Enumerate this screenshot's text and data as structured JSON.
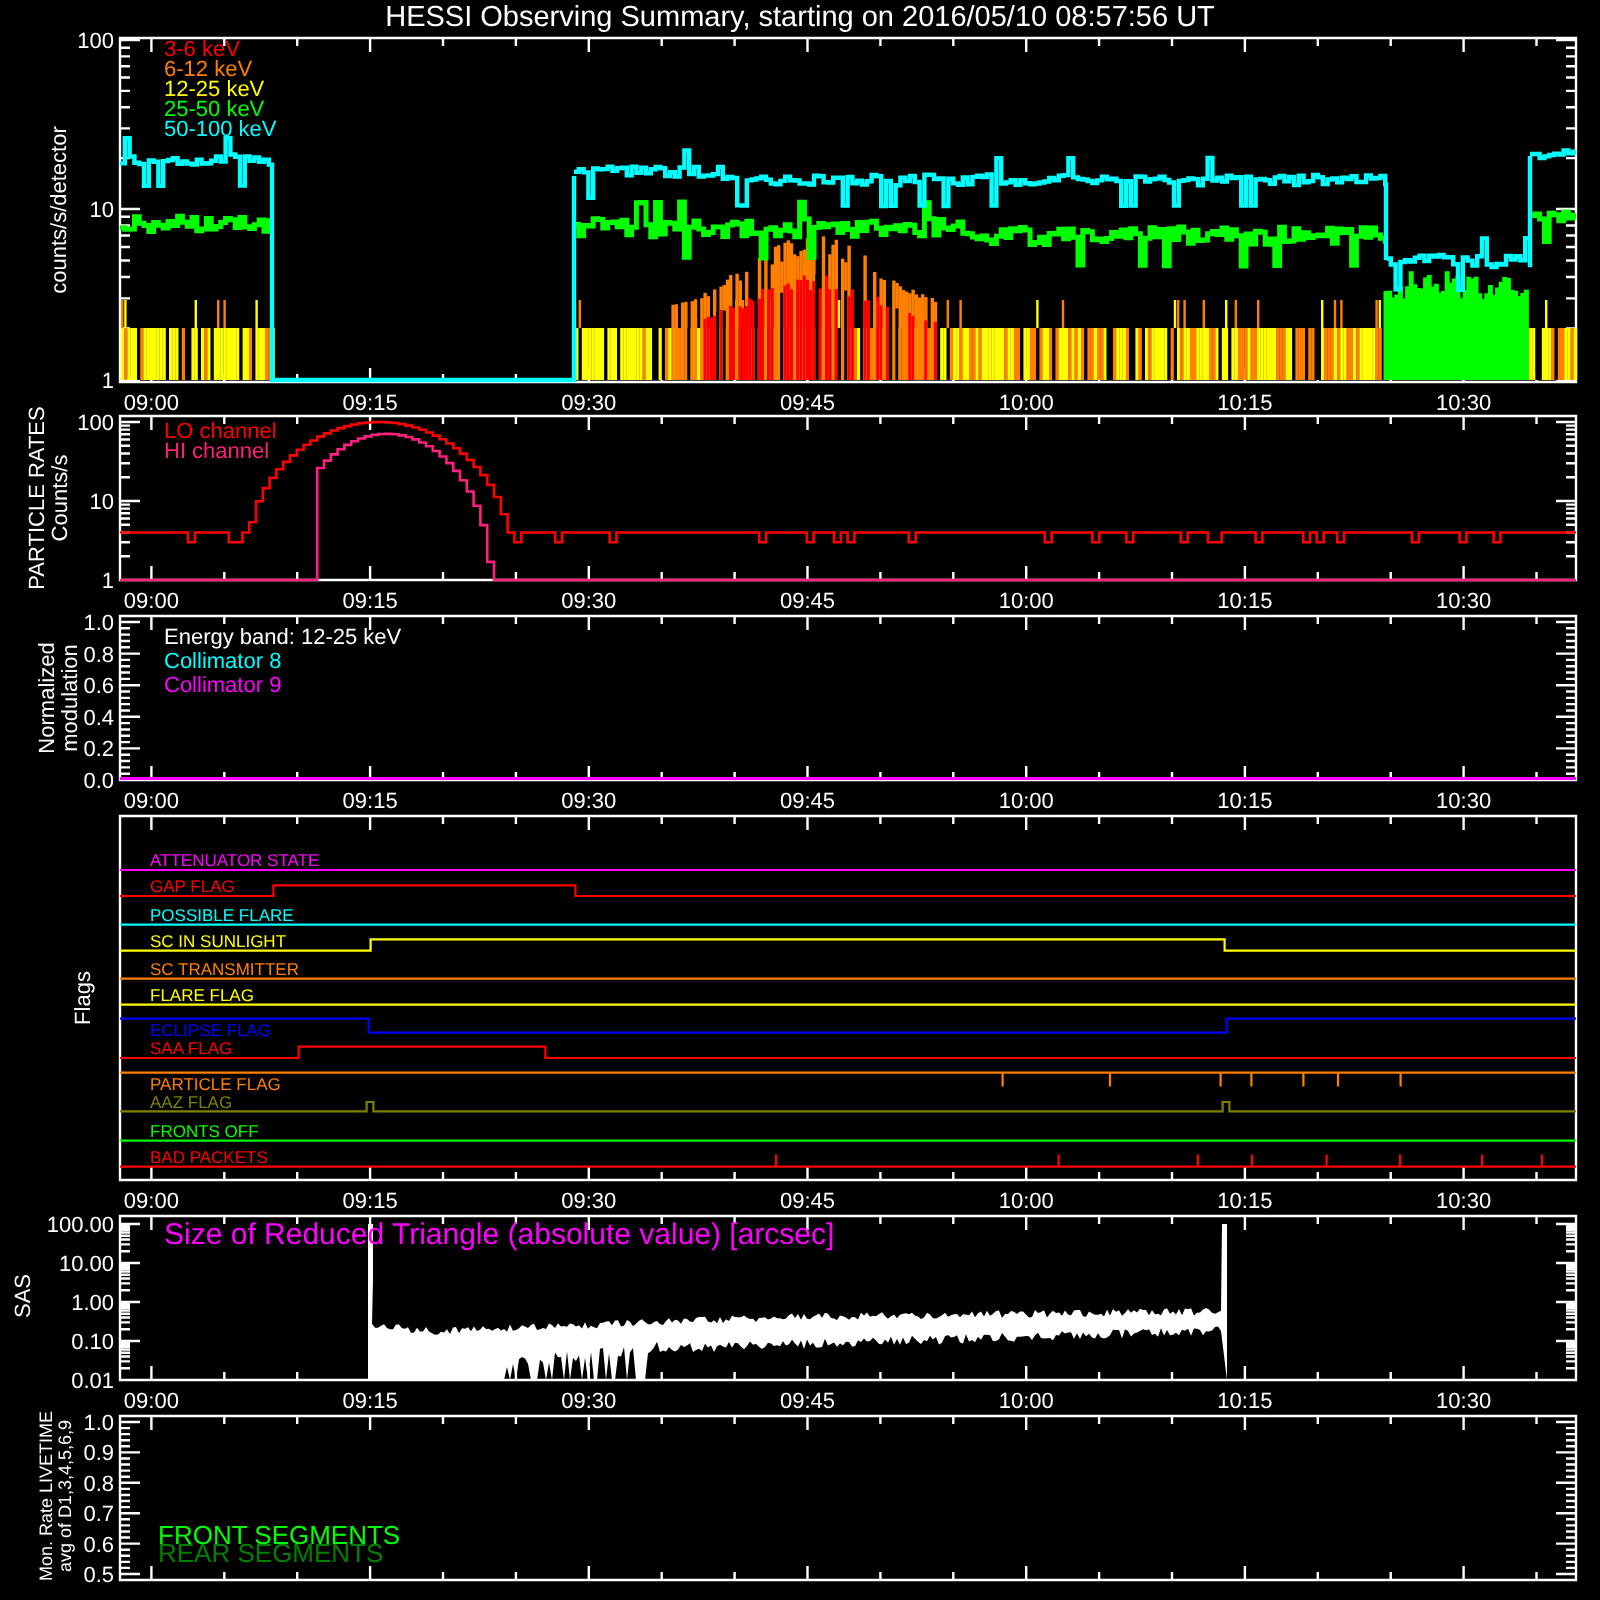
{
  "title": "HESSI Observing Summary, starting on 2016/05/10 08:57:56 UT",
  "panels": [
    {
      "kind": "counts",
      "ylabel": [
        "counts/s/detector"
      ],
      "yticks": [
        "100",
        "10",
        "1"
      ],
      "legend": [
        {
          "label": "3-6 keV",
          "color": "#ff0000"
        },
        {
          "label": "6-12 keV",
          "color": "#ff8000"
        },
        {
          "label": "12-25 keV",
          "color": "#ffff00"
        },
        {
          "label": "25-50 keV",
          "color": "#00ff00"
        },
        {
          "label": "50-100 keV",
          "color": "#00ffff"
        }
      ],
      "time_labels": [
        "09:00",
        "09:15",
        "09:30",
        "09:45",
        "10:00",
        "10:15",
        "10:30"
      ]
    },
    {
      "kind": "particles",
      "ylabel": [
        "PARTICLE RATES",
        "Counts/s"
      ],
      "yticks": [
        "100",
        "10",
        "1"
      ],
      "legend": [
        {
          "label": "LO channel",
          "color": "#ff0000"
        },
        {
          "label": "HI channel",
          "color": "#ff1f7f"
        }
      ],
      "time_labels": [
        "09:00",
        "09:15",
        "09:30",
        "09:45",
        "10:00",
        "10:15",
        "10:30"
      ]
    },
    {
      "kind": "modulation",
      "ylabel": [
        "Normalized",
        "modulation"
      ],
      "yticks": [
        "1.0",
        "0.8",
        "0.6",
        "0.4",
        "0.2",
        "0.0"
      ],
      "legend": [
        {
          "label": "Energy band: 12-25 keV",
          "color": "#ffffff"
        },
        {
          "label": "Collimator 8",
          "color": "#00ffff"
        },
        {
          "label": "Collimator 9",
          "color": "#ff00ff"
        }
      ],
      "time_labels": [
        "09:00",
        "09:15",
        "09:30",
        "09:45",
        "10:00",
        "10:15",
        "10:30"
      ]
    },
    {
      "kind": "flags",
      "ylabel": [
        "Flags"
      ],
      "flags": [
        {
          "label": "ATTENUATOR STATE",
          "color": "#ff00ff"
        },
        {
          "label": "GAP FLAG",
          "color": "#ff0000"
        },
        {
          "label": "POSSIBLE FLARE",
          "color": "#00ffff"
        },
        {
          "label": "SC IN SUNLIGHT",
          "color": "#ffff00"
        },
        {
          "label": "SC TRANSMITTER",
          "color": "#ff8000"
        },
        {
          "label": "FLARE FLAG",
          "color": "#ffff00"
        },
        {
          "label": "ECLIPSE FLAG",
          "color": "#0000ff"
        },
        {
          "label": "SAA FLAG",
          "color": "#ff0000"
        },
        {
          "label": "PARTICLE FLAG",
          "color": "#ff8000"
        },
        {
          "label": "AAZ FLAG",
          "color": "#808000"
        },
        {
          "label": "FRONTS OFF",
          "color": "#00ff00"
        },
        {
          "label": "BAD PACKETS",
          "color": "#ff0000"
        }
      ],
      "time_labels": [
        "09:00",
        "09:15",
        "09:30",
        "09:45",
        "10:00",
        "10:15",
        "10:30"
      ]
    },
    {
      "kind": "sas",
      "ylabel": [
        "SAS"
      ],
      "yticks": [
        "100.00",
        "10.00",
        "1.00",
        "0.10",
        "0.01"
      ],
      "legend": [
        {
          "label": "Size of Reduced Triangle (absolute value) [arcsec]",
          "color": "#ff00ff"
        }
      ],
      "time_labels": [
        "09:00",
        "09:15",
        "09:30",
        "09:45",
        "10:00",
        "10:15",
        "10:30"
      ]
    },
    {
      "kind": "livetime",
      "ylabel": [
        "Mon. Rate LIVETIME",
        "avg of D1,3,4,5,6,9"
      ],
      "yticks": [
        "1.0",
        "0.9",
        "0.8",
        "0.7",
        "0.6",
        "0.5"
      ],
      "legend": [
        {
          "label": "FRONT SEGMENTS",
          "color": "#00ff00"
        },
        {
          "label": "REAR SEGMENTS",
          "color": "#008000"
        }
      ]
    }
  ]
}
